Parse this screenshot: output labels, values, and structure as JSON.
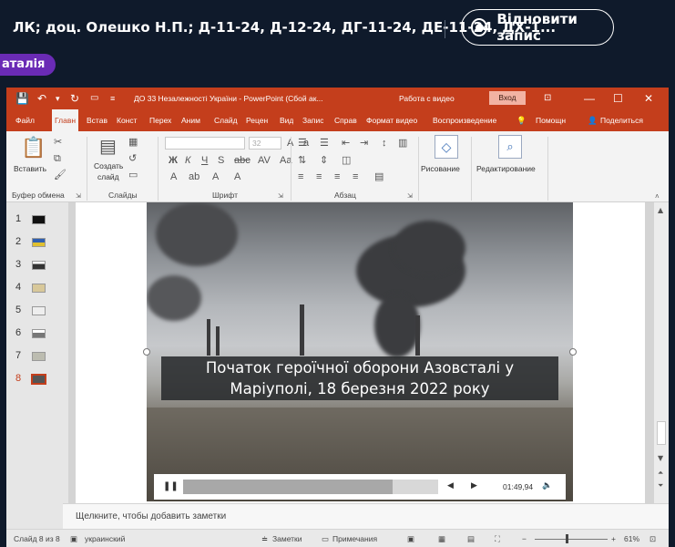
{
  "meeting": {
    "title": "ЛК; доц. Олешко Н.П.; Д-11-24, Д-12-24, ДГ-11-24, ДЕ-11-24, ДХ-1...",
    "resume_label": "Відновити запис",
    "participant_chip": "аталія"
  },
  "ppt": {
    "window_title": "ДО 33 Незалежності України  -  PowerPoint (Сбой ак...",
    "context_tab": "Работа с видео",
    "login_label": "Вход",
    "tabs": [
      {
        "label": "Файл"
      },
      {
        "label": "Главн"
      },
      {
        "label": "Встав"
      },
      {
        "label": "Конст"
      },
      {
        "label": "Перех"
      },
      {
        "label": "Аним"
      },
      {
        "label": "Слайд"
      },
      {
        "label": "Рецен"
      },
      {
        "label": "Вид"
      },
      {
        "label": "Запис"
      },
      {
        "label": "Справ"
      },
      {
        "label": "Формат видео"
      },
      {
        "label": "Воспроизведение"
      },
      {
        "label": "Помощн"
      },
      {
        "label": "Поделиться"
      }
    ],
    "ribbon": {
      "paste": "Вставить",
      "create_slide_1": "Создать",
      "create_slide_2": "слайд",
      "drawing": "Рисование",
      "editing": "Редактирование",
      "font_size": "32",
      "groups": {
        "clipboard": "Буфер обмена",
        "slides": "Слайды",
        "font": "Шрифт",
        "paragraph": "Абзац"
      }
    },
    "thumbnails": [
      "1",
      "2",
      "3",
      "4",
      "5",
      "6",
      "7",
      "8"
    ],
    "active_slide_index": 7,
    "slide": {
      "caption_line1": "Початок героїчної оборони Азовсталі у",
      "caption_line2": "Маріуполі, 18 березня 2022 року",
      "video_time": "01:49,94",
      "video_progress": 0.82
    },
    "notes_placeholder": "Щелкните, чтобы добавить заметки",
    "status": {
      "slide_info": "Слайд 8 из 8",
      "language": "украинский",
      "notes_label": "Заметки",
      "comments_label": "Примечания",
      "zoom": "61%",
      "zoom_level": 0.61
    }
  },
  "colors": {
    "app_bg": "#0f1a2b",
    "ppt_accent": "#c43e1c",
    "chip": "#6a2bb5"
  }
}
